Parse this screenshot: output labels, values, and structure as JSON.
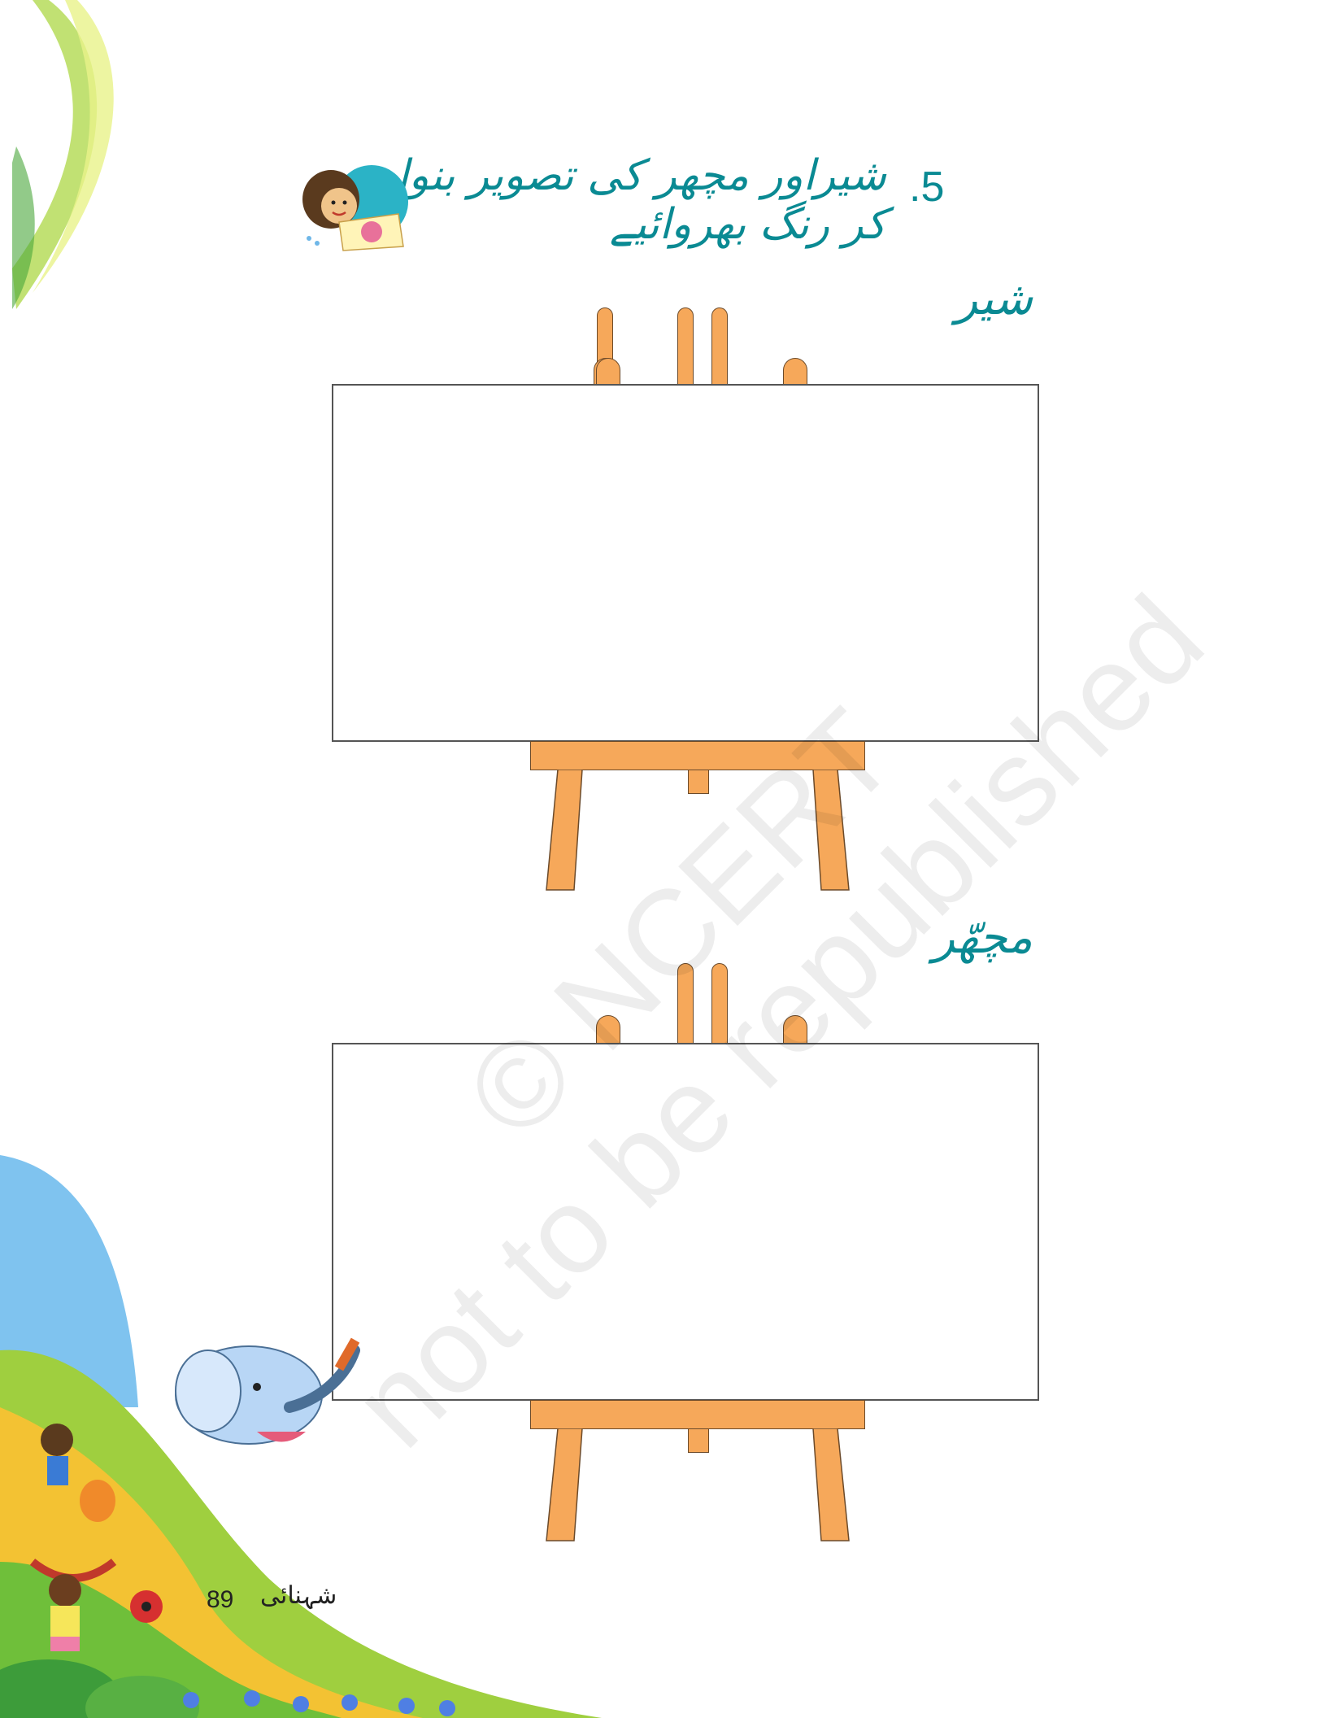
{
  "question": {
    "number": "5.",
    "text": "شیراور مچھر کی تصویر بنوا کر رنگ بھروائیے"
  },
  "drawing_boxes": [
    {
      "label": "شیر"
    },
    {
      "label": "مچھّر"
    }
  ],
  "footer": {
    "page_number": "89",
    "book_title": "شہنائی"
  },
  "watermark": {
    "line1": "© NCERT",
    "line2": "not to be republished"
  },
  "icons": {
    "header_illustration": "child-painting-icon",
    "elephant": "elephant-with-brush-icon",
    "kids_corner": "kids-playing-illustration"
  },
  "colors": {
    "heading": "#0a8a93",
    "easel": "#f6a85a"
  }
}
